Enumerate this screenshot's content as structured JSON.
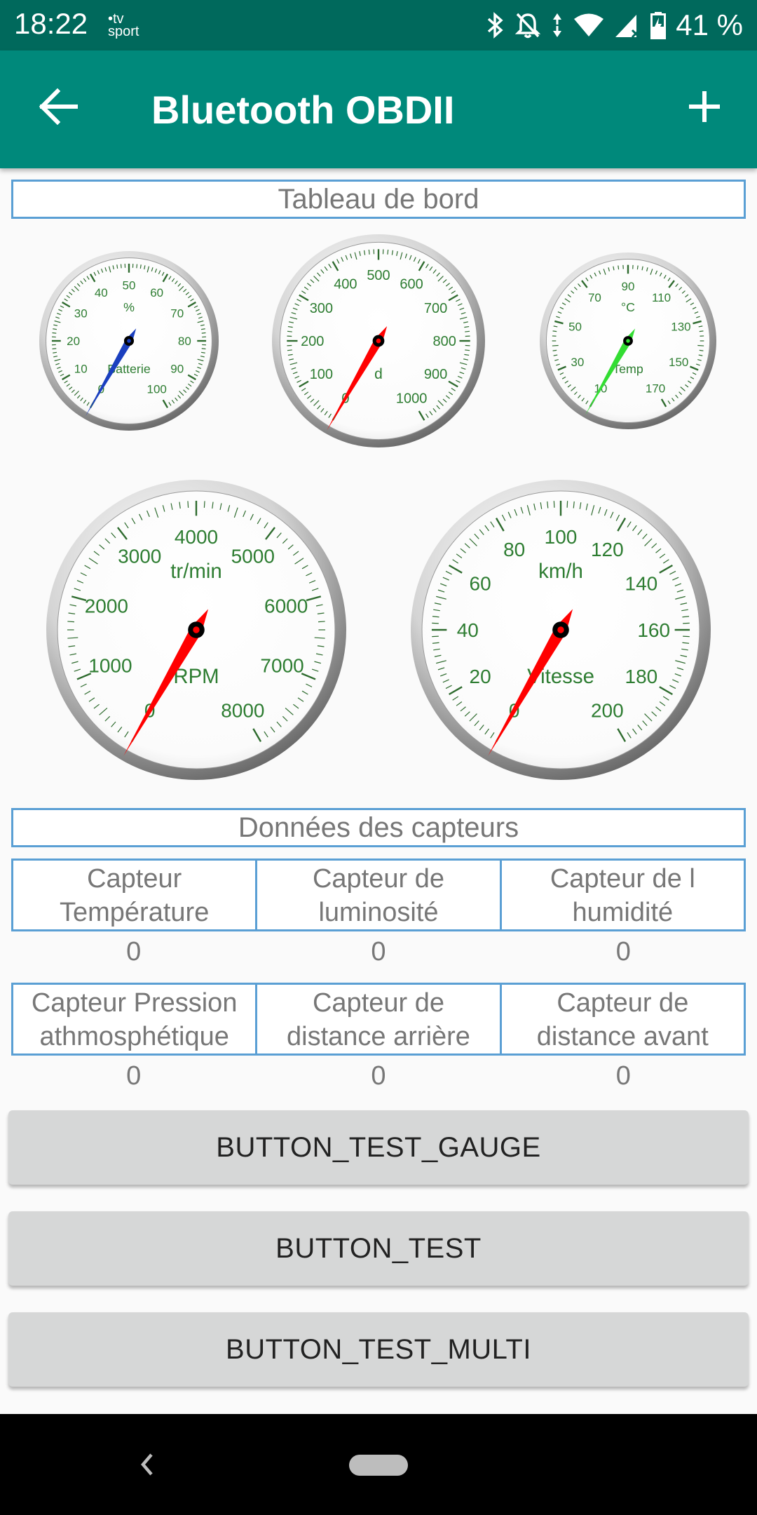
{
  "status_bar": {
    "time": "18:22",
    "tv_label_top": "•tv",
    "tv_label_bottom": "sport",
    "battery": "41 %",
    "icons": [
      "bluetooth-icon",
      "bell-off-icon",
      "data-arrows-icon",
      "wifi-icon",
      "signal-icon",
      "battery-icon"
    ]
  },
  "app_bar": {
    "title": "Bluetooth OBDII",
    "back_icon": "arrow-back-icon",
    "add_icon": "plus-icon",
    "color": "#00897b",
    "status_color": "#00695c"
  },
  "dashboard": {
    "header": "Tableau de bord",
    "gauges": [
      {
        "name": "battery",
        "unit": "%",
        "label": "Batterie",
        "ticks": [
          "0",
          "10",
          "20",
          "30",
          "40",
          "50",
          "60",
          "70",
          "80",
          "90",
          "100"
        ],
        "value": 0,
        "needle_color": "#1a3fbf"
      },
      {
        "name": "distance",
        "unit": "",
        "label": "d",
        "ticks": [
          "0",
          "100",
          "200",
          "300",
          "400",
          "500",
          "600",
          "700",
          "800",
          "900",
          "1000"
        ],
        "value": 0,
        "needle_color": "#ff0000"
      },
      {
        "name": "temperature",
        "unit": "°C",
        "label": "Temp",
        "ticks": [
          "10",
          "30",
          "50",
          "70",
          "90",
          "110",
          "130",
          "150",
          "170"
        ],
        "value": 10,
        "needle_color": "#33dd33"
      },
      {
        "name": "rpm",
        "unit": "tr/min",
        "label": "RPM",
        "ticks": [
          "0",
          "1000",
          "2000",
          "3000",
          "4000",
          "5000",
          "6000",
          "7000",
          "8000"
        ],
        "value": 0,
        "needle_color": "#ff0000"
      },
      {
        "name": "speed",
        "unit": "km/h",
        "label": "Vitesse",
        "ticks": [
          "0",
          "20",
          "40",
          "60",
          "80",
          "100",
          "120",
          "140",
          "160",
          "180",
          "200"
        ],
        "value": 0,
        "needle_color": "#ff0000"
      }
    ]
  },
  "sensors": {
    "header": "Données des capteurs",
    "row1": [
      {
        "label_line1": "Capteur",
        "label_line2": "Température",
        "value": "0"
      },
      {
        "label_line1": "Capteur de",
        "label_line2": "luminosité",
        "value": "0"
      },
      {
        "label_line1": "Capteur de l",
        "label_line2": "humidité",
        "value": "0"
      }
    ],
    "row2": [
      {
        "label_line1": "Capteur Pression",
        "label_line2": "athmosphétique",
        "value": "0"
      },
      {
        "label_line1": "Capteur de",
        "label_line2": "distance arrière",
        "value": "0"
      },
      {
        "label_line1": "Capteur de",
        "label_line2": "distance avant",
        "value": "0"
      }
    ]
  },
  "buttons": {
    "test_gauge": "BUTTON_TEST_GAUGE",
    "test": "BUTTON_TEST",
    "test_multi": "BUTTON_TEST_MULTI"
  },
  "nav_bar": {
    "back_icon": "nav-back-icon",
    "home_icon": "nav-home-pill-icon"
  }
}
